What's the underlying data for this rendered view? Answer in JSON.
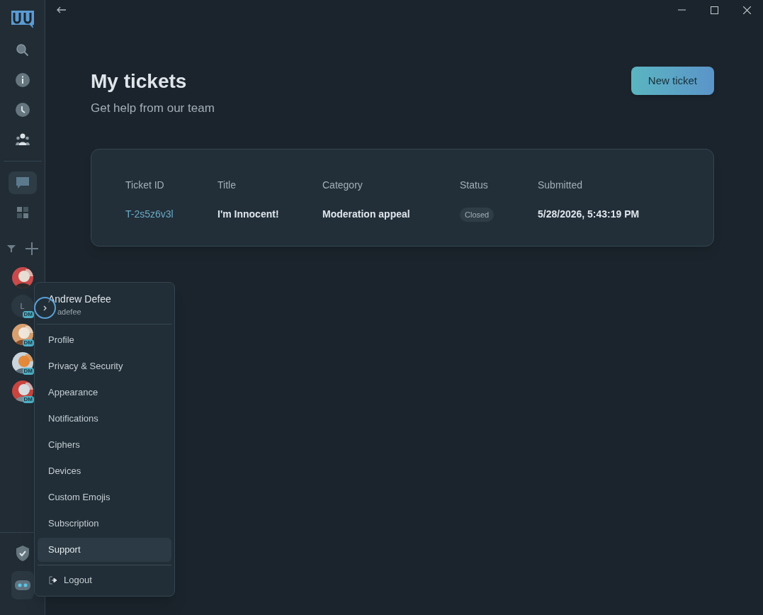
{
  "sidebar": {
    "nav": [
      {
        "kind": "search",
        "selected": false
      },
      {
        "kind": "info",
        "selected": false
      },
      {
        "kind": "clock",
        "selected": false
      },
      {
        "kind": "people",
        "selected": false
      },
      {
        "kind": "chat",
        "selected": true
      },
      {
        "kind": "grid",
        "selected": false
      }
    ],
    "avatars": [
      {
        "kind": "group"
      },
      {
        "kind": "letter",
        "letter": "L",
        "badge": "DM"
      },
      {
        "kind": "picture",
        "badge": "DM"
      },
      {
        "kind": "picture",
        "badge": "DM"
      },
      {
        "kind": "picture",
        "badge": "DM"
      }
    ]
  },
  "page": {
    "title": "My tickets",
    "subtitle": "Get help from our team",
    "new_ticket_button": "New ticket"
  },
  "table": {
    "columns": [
      "Ticket ID",
      "Title",
      "Category",
      "Status",
      "Submitted"
    ],
    "rows": [
      {
        "ticket_id": "T-2s5z6v3l",
        "title": "I'm Innocent!",
        "category": "Moderation appeal",
        "status": "Closed",
        "submitted": "5/28/2026, 5:43:19 PM"
      }
    ]
  },
  "user_menu": {
    "name": "Andrew Defee",
    "handle": "adefee",
    "items": [
      {
        "label": "Profile",
        "selected": false
      },
      {
        "label": "Privacy & Security",
        "selected": false
      },
      {
        "label": "Appearance",
        "selected": false
      },
      {
        "label": "Notifications",
        "selected": false
      },
      {
        "label": "Ciphers",
        "selected": false
      },
      {
        "label": "Devices",
        "selected": false
      },
      {
        "label": "Custom Emojis",
        "selected": false
      },
      {
        "label": "Subscription",
        "selected": false
      },
      {
        "label": "Support",
        "selected": true
      }
    ],
    "logout": "Logout"
  }
}
